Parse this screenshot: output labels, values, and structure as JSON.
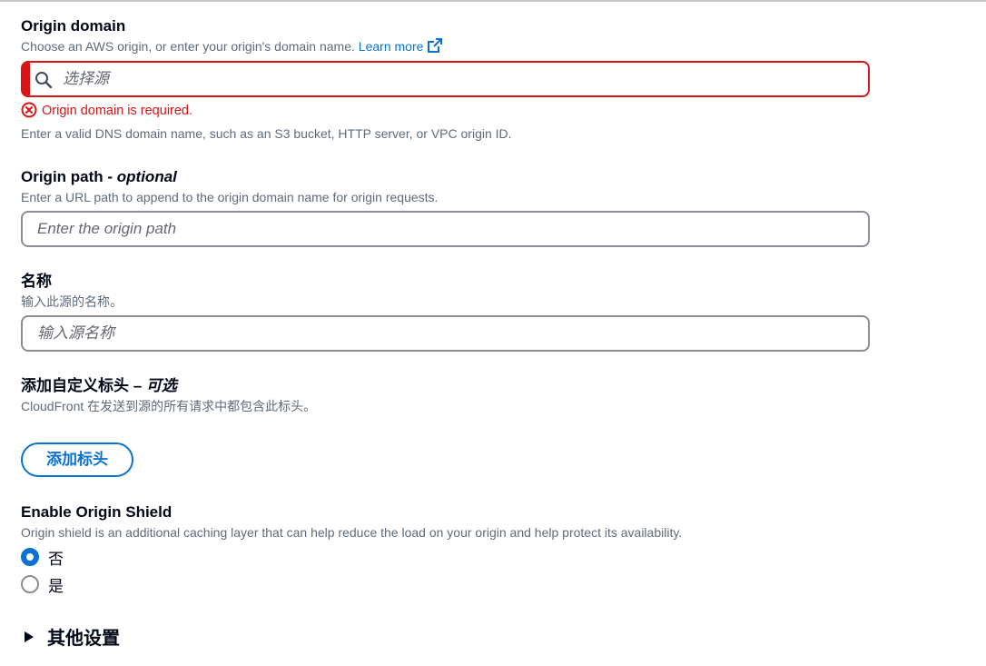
{
  "origin_domain": {
    "label": "Origin domain",
    "description": "Choose an AWS origin, or enter your origin's domain name.",
    "learn_more": "Learn more",
    "placeholder": "选择源",
    "error": "Origin domain is required.",
    "constraint": "Enter a valid DNS domain name, such as an S3 bucket, HTTP server, or VPC origin ID."
  },
  "origin_path": {
    "label": "Origin path - ",
    "label_optional": "optional",
    "description": "Enter a URL path to append to the origin domain name for origin requests.",
    "placeholder": "Enter the origin path"
  },
  "name": {
    "label": "名称",
    "description": "输入此源的名称。",
    "placeholder": "输入源名称"
  },
  "custom_header": {
    "label": "添加自定义标头 – ",
    "label_optional": "可选",
    "description": "CloudFront 在发送到源的所有请求中都包含此标头。",
    "button": "添加标头"
  },
  "origin_shield": {
    "label": "Enable Origin Shield",
    "description": "Origin shield is an additional caching layer that can help reduce the load on your origin and help protect its availability.",
    "options": [
      {
        "label": "否",
        "checked": true
      },
      {
        "label": "是",
        "checked": false
      }
    ]
  },
  "other_settings": {
    "label": "其他设置"
  },
  "colors": {
    "link": "#0972d3",
    "error": "#d91515",
    "border": "#8c8c94"
  },
  "icons": [
    "search-icon",
    "external-link-icon",
    "error-icon",
    "caret-right-icon"
  ]
}
